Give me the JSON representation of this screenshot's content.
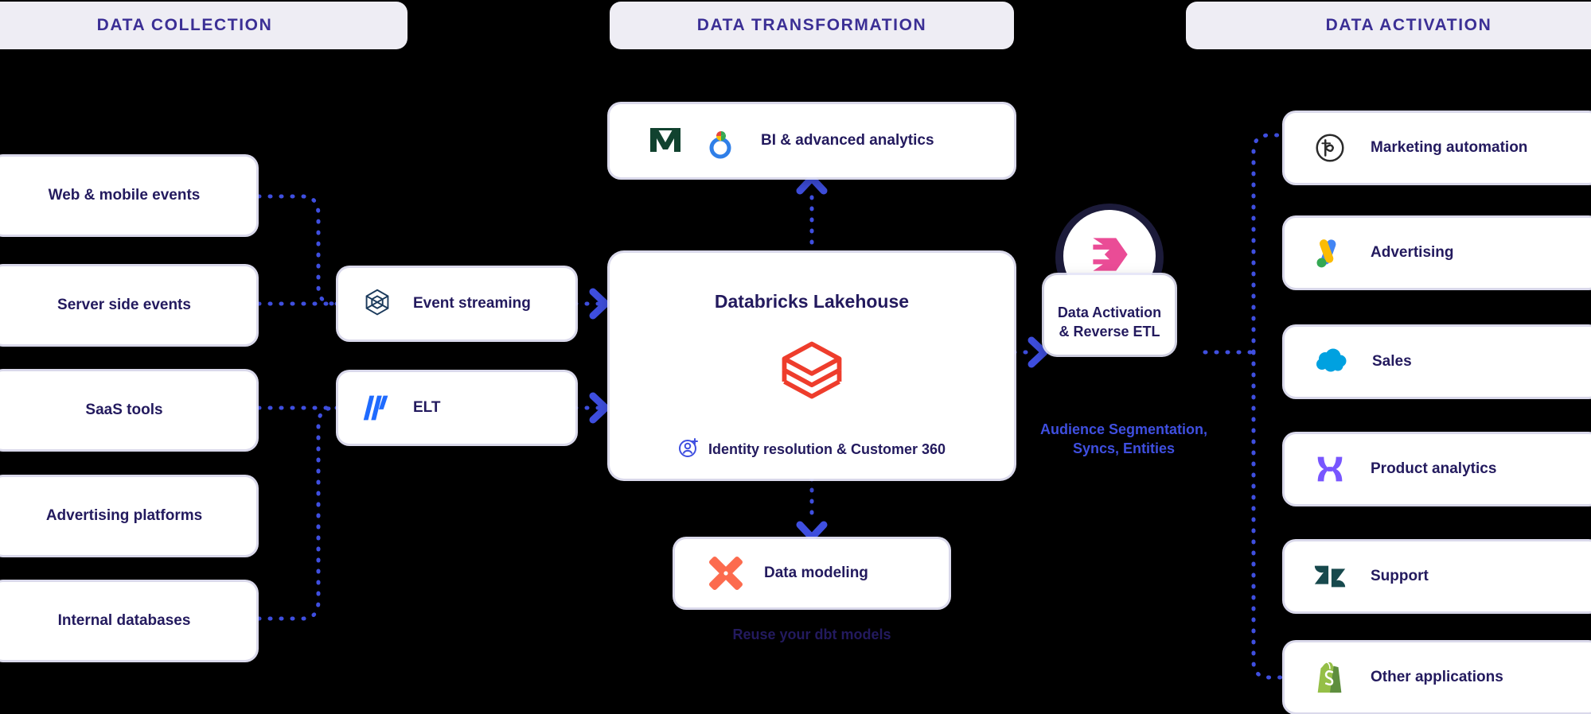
{
  "columns": [
    {
      "id": "collection",
      "title": "DATA COLLECTION"
    },
    {
      "id": "transformation",
      "title": "DATA TRANSFORMATION"
    },
    {
      "id": "activation",
      "title": "DATA ACTIVATION"
    }
  ],
  "sources": [
    {
      "label": "Web & mobile events"
    },
    {
      "label": "Server side events"
    },
    {
      "label": "SaaS tools"
    },
    {
      "label": "Advertising platforms"
    },
    {
      "label": "Internal databases"
    }
  ],
  "ingestion": [
    {
      "label": "Event streaming",
      "icon": "confluent-hexagon-icon"
    },
    {
      "label": "ELT",
      "icon": "fivetran-bars-icon"
    }
  ],
  "analytics": {
    "label": "BI & advanced analytics",
    "icons": [
      "mode-m-icon",
      "looker-rings-icon"
    ]
  },
  "lakehouse": {
    "title": "Databricks Lakehouse",
    "logo_icon": "databricks-stack-icon",
    "feature_icon": "user-plus-circle-icon",
    "feature_label": "Identity resolution & Customer 360"
  },
  "modeling": {
    "label": "Data modeling",
    "icon": "dbt-x-icon",
    "caption": "Reuse your dbt models"
  },
  "activation_node": {
    "logo_icon": "hightouch-hexagon-icon",
    "line1": "Data Activation",
    "line2": "& Reverse ETL",
    "caption_line1": "Audience Segmentation,",
    "caption_line2": "Syncs, Entities"
  },
  "destinations": [
    {
      "label": "Marketing automation",
      "icon": "braze-b-circle-icon"
    },
    {
      "label": "Advertising",
      "icon": "google-ads-icon"
    },
    {
      "label": "Sales",
      "icon": "salesforce-cloud-icon"
    },
    {
      "label": "Product analytics",
      "icon": "mixpanel-x-icon"
    },
    {
      "label": "Support",
      "icon": "zendesk-z-icon"
    },
    {
      "label": "Other applications",
      "icon": "shopify-bag-icon"
    }
  ],
  "colors": {
    "background": "#000000",
    "header_bg": "#eeedf4",
    "header_text": "#3b2f95",
    "card_bg": "#ffffff",
    "card_text": "#231a5e",
    "wire": "#3f4fe0",
    "caption_accent": "#3f4fe0",
    "databricks_red": "#ee3d2c",
    "dbt_orange": "#fc6b4e",
    "hightouch_pink": "#ea4c96",
    "activation_ring": "#1c1b3a"
  }
}
